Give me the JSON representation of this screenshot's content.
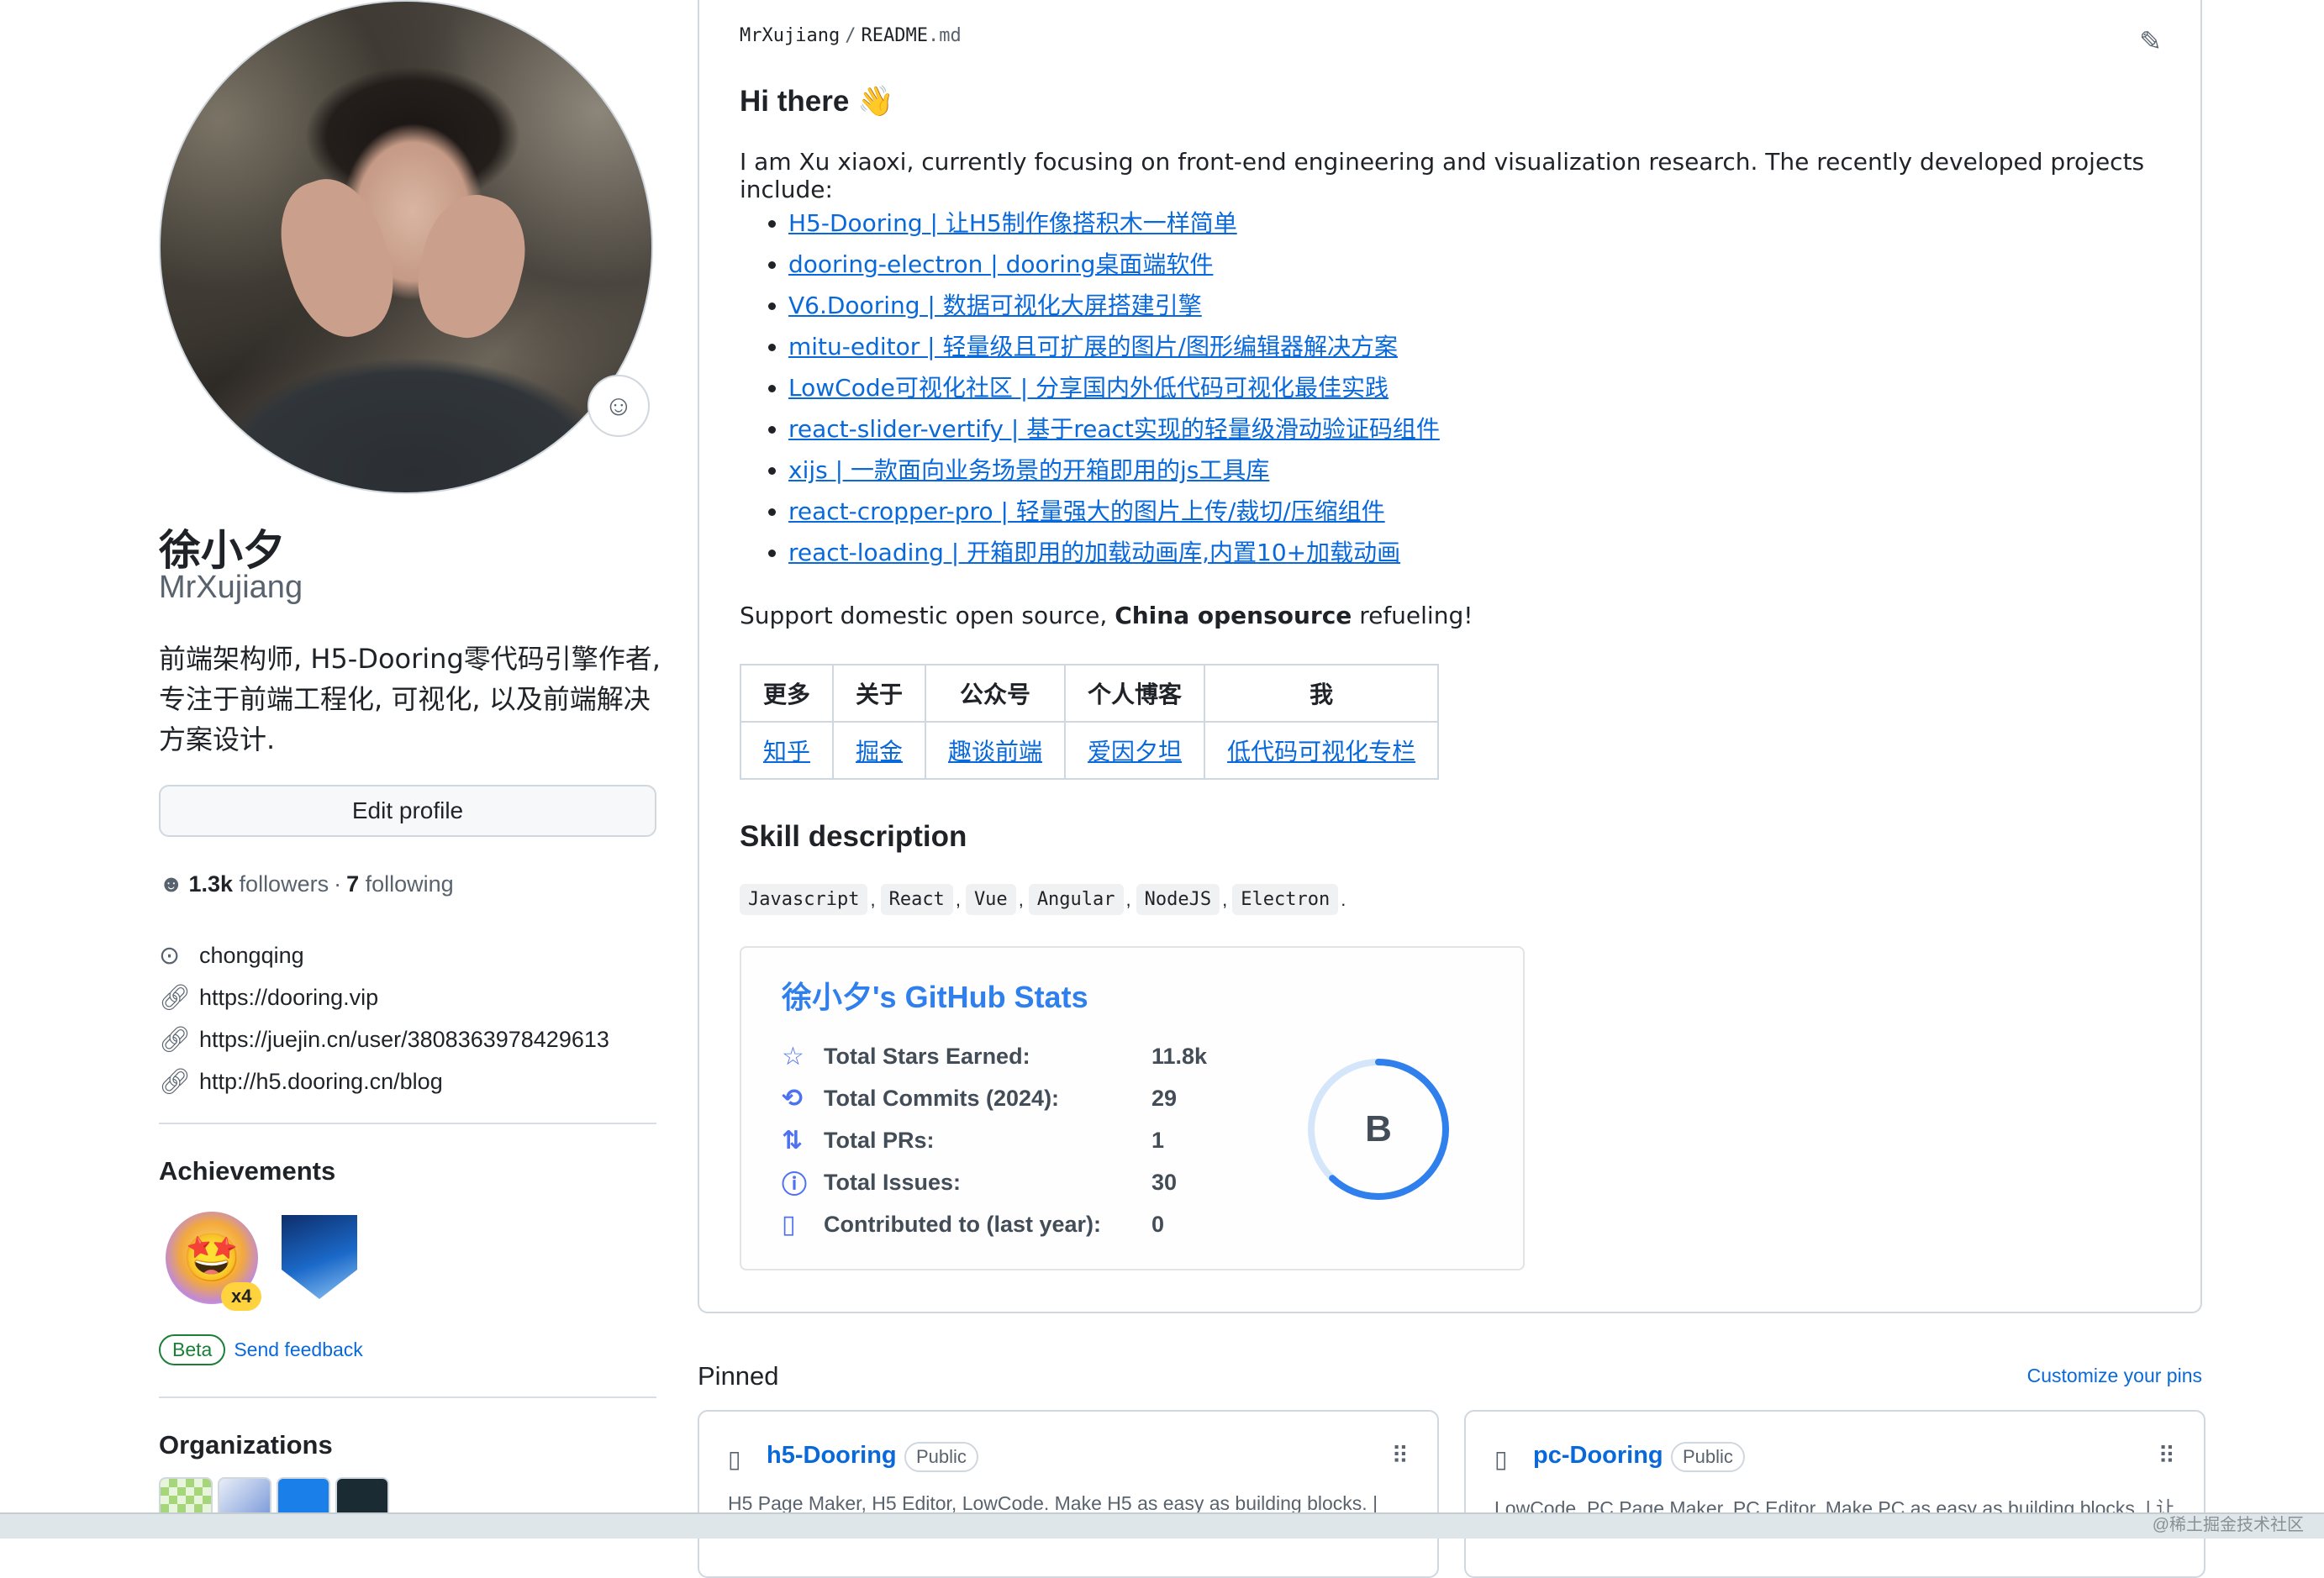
{
  "profile": {
    "fullname": "徐小夕",
    "login": "MrXujiang",
    "bio": "前端架构师, H5-Dooring零代码引擎作者, 专注于前端工程化, 可视化, 以及前端解决方案设计.",
    "edit_label": "Edit profile",
    "followers_count": "1.3k",
    "followers_label": "followers",
    "dot": "·",
    "following_count": "7",
    "following_label": "following",
    "location": "chongqing",
    "links": [
      "https://dooring.vip",
      "https://juejin.cn/user/3808363978429613",
      "http://h5.dooring.cn/blog"
    ]
  },
  "achievements": {
    "title": "Achievements",
    "badge_count": "x4",
    "beta_label": "Beta",
    "feedback_label": "Send feedback"
  },
  "organizations": {
    "title": "Organizations"
  },
  "readme": {
    "path_owner": "MrXujiang",
    "path_sep": "/",
    "path_file": "README",
    "path_ext": ".md",
    "greeting": "Hi there 👋",
    "intro": "I am Xu xiaoxi, currently focusing on front-end engineering and visualization research. The recently developed projects include:",
    "projects": [
      "H5-Dooring | 让H5制作像搭积木一样简单",
      "dooring-electron | dooring桌面端软件",
      "V6.Dooring | 数据可视化大屏搭建引擎",
      "mitu-editor | 轻量级且可扩展的图片/图形编辑器解决方案",
      "LowCode可视化社区 | 分享国内外低代码可视化最佳实践",
      "react-slider-vertify | 基于react实现的轻量级滑动验证码组件",
      "xijs | 一款面向业务场景的开箱即用的js工具库",
      "react-cropper-pro | 轻量强大的图片上传/裁切/压缩组件",
      "react-loading | 开箱即用的加载动画库,内置10+加载动画"
    ],
    "support_prefix": "Support domestic open source, ",
    "support_bold": "China opensource",
    "support_suffix": " refueling!",
    "table_headers": [
      "更多",
      "关于",
      "公众号",
      "个人博客",
      "我"
    ],
    "table_links": [
      "知乎",
      "掘金",
      "趣谈前端",
      "爱因夕坦",
      "低代码可视化专栏"
    ],
    "skill_title": "Skill description",
    "skills": [
      "Javascript",
      "React",
      "Vue",
      "Angular",
      "NodeJS",
      "Electron"
    ],
    "skills_end": "."
  },
  "stats": {
    "title": "徐小夕's GitHub Stats",
    "rows": [
      {
        "label": "Total Stars Earned:",
        "value": "11.8k",
        "icon": "star-icon"
      },
      {
        "label": "Total Commits (2024):",
        "value": "29",
        "icon": "history-icon"
      },
      {
        "label": "Total PRs:",
        "value": "1",
        "icon": "pull-request-icon"
      },
      {
        "label": "Total Issues:",
        "value": "30",
        "icon": "issue-icon"
      },
      {
        "label": "Contributed to (last year):",
        "value": "0",
        "icon": "repo-icon"
      }
    ],
    "rank": "B",
    "rank_progress": 0.62,
    "colors": {
      "title": "#2f80ed",
      "icon": "#4c71f2",
      "ring": "#2f80ed",
      "ring_bg": "#d5e6fb"
    }
  },
  "pinned": {
    "title": "Pinned",
    "customize_label": "Customize your pins",
    "repos": [
      {
        "name": "h5-Dooring",
        "visibility": "Public",
        "description": "H5 Page Maker, H5 Editor, LowCode. Make H5 as easy as building blocks. |"
      },
      {
        "name": "pc-Dooring",
        "visibility": "Public",
        "description": "LowCode, PC Page Maker, PC Editor. Make PC as easy as building blocks. | 让"
      }
    ]
  },
  "watermark": "@稀土掘金技术社区"
}
